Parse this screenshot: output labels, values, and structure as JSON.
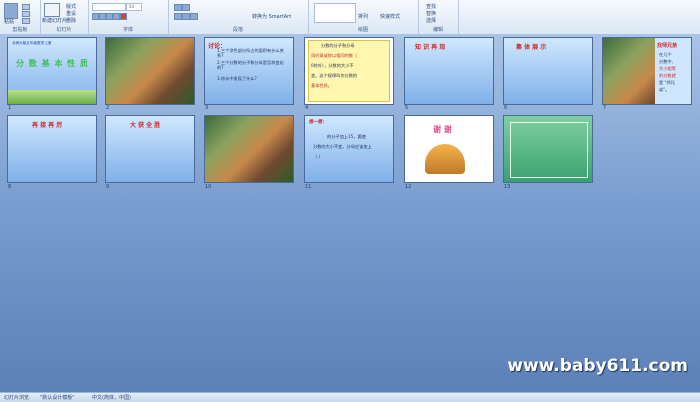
{
  "ribbon": {
    "groups": [
      {
        "label": "剪贴板"
      },
      {
        "label": "幻灯片"
      },
      {
        "label": "字体"
      },
      {
        "label": "段落"
      },
      {
        "label": "绘图"
      },
      {
        "label": "编辑"
      }
    ],
    "buttons": {
      "paste": "粘贴",
      "new_slide": "新建幻灯片",
      "layout": "版式",
      "reset": "重设",
      "delete": "删除",
      "font_size": "54",
      "smartart": "转换为 SmartArt",
      "arrange": "排列",
      "quick_styles": "快速样式",
      "find": "查找",
      "replace": "替换",
      "select": "选择"
    }
  },
  "slides": [
    {
      "num": "1",
      "title": "分 数 基 本 性 质",
      "header": "北师大版五年级数学上册"
    },
    {
      "num": "2"
    },
    {
      "num": "3",
      "title": "讨论：",
      "lines": [
        "1.三个涂色部分所占的面积有什么关系?",
        "2.三个分数的分子和分母是怎样变化的?",
        "3.你从中发现了什么?"
      ]
    },
    {
      "num": "4",
      "lines": [
        "分数的分子和分母",
        "同时乘或除以相同的数（",
        "0除外），分数的大小不",
        "变。这个规律叫作分数的",
        "基本性质。"
      ]
    },
    {
      "num": "5",
      "title": "知 识 再 现"
    },
    {
      "num": "6",
      "title": "集 体 展 示"
    },
    {
      "num": "7",
      "title": "找师兄弟",
      "lines": [
        "在几个",
        "分数中,",
        "大小相等",
        "的分数就",
        "是 \"师兄",
        "弟\"。"
      ]
    },
    {
      "num": "8",
      "title": "再 接 再 厉"
    },
    {
      "num": "9",
      "title": "大 获 全 胜"
    },
    {
      "num": "10"
    },
    {
      "num": "11",
      "title": "想一想：",
      "lines": [
        "的分子加上15，要使",
        "分数的大小不变，分母应该加上",
        "（    ）"
      ]
    },
    {
      "num": "12",
      "title": "谢   谢"
    },
    {
      "num": "13"
    }
  ],
  "watermark": "www.baby611.com",
  "status": {
    "slide_view": "幻灯片浏览",
    "theme": "\"默认设计模板\"",
    "language": "中文(简体，中国)"
  }
}
